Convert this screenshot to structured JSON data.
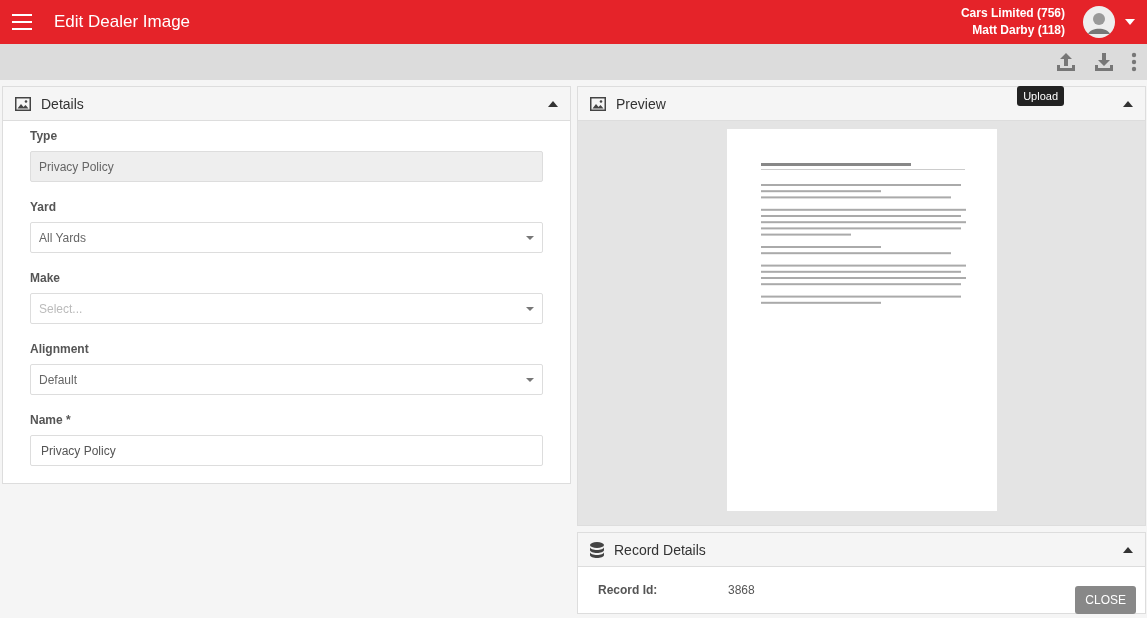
{
  "header": {
    "title": "Edit Dealer Image",
    "account": "Cars Limited (756)",
    "user": "Matt Darby (118)"
  },
  "toolbar": {
    "tooltip": "Upload"
  },
  "details": {
    "title": "Details",
    "expanded": true,
    "fields": [
      {
        "kind": "readonly",
        "label": "Type",
        "value": "Privacy Policy"
      },
      {
        "kind": "select",
        "label": "Yard",
        "value": "All Yards"
      },
      {
        "kind": "select",
        "label": "Make",
        "placeholder": "Select..."
      },
      {
        "kind": "select",
        "label": "Alignment",
        "value": "Default"
      },
      {
        "kind": "text",
        "label": "Name *",
        "value": "Privacy Policy"
      }
    ]
  },
  "preview": {
    "title": "Preview",
    "expanded": true
  },
  "record_details": {
    "title": "Record Details",
    "expanded": true,
    "rows": [
      {
        "label": "Record Id:",
        "value": "3868"
      }
    ]
  },
  "close_button": "CLOSE"
}
